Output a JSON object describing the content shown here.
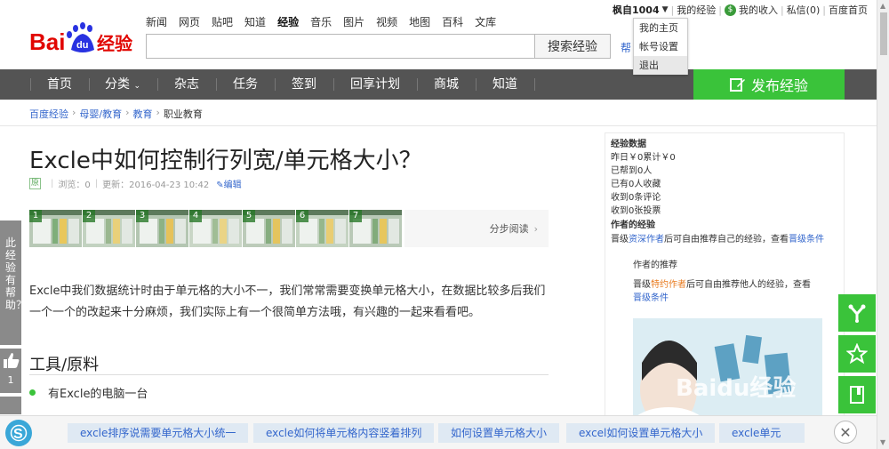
{
  "header": {
    "logo_text": "Bai经验",
    "top_nav": [
      "新闻",
      "网页",
      "贴吧",
      "知道",
      "经验",
      "音乐",
      "图片",
      "视频",
      "地图",
      "百科",
      "文库"
    ],
    "search_button": "搜索经验",
    "help_link": "帮"
  },
  "userbar": {
    "username": "枫自1004",
    "my_experience": "我的经验",
    "my_income": "我的收入",
    "messages": "私信(0)",
    "home": "百度首页"
  },
  "user_dropdown": [
    "我的主页",
    "帐号设置",
    "退出"
  ],
  "navbar": {
    "items": [
      "首页",
      "分类",
      "杂志",
      "任务",
      "签到",
      "回享计划",
      "商城",
      "知道"
    ],
    "publish": "发布经验"
  },
  "breadcrumb": [
    "百度经验",
    "母婴/教育",
    "教育",
    "职业教育"
  ],
  "article": {
    "title": "Excle中如何控制行列宽/单元格大小？",
    "original_badge": "原",
    "views": "浏览：0",
    "updated": "更新：2016-04-23 10:42",
    "edit": "编辑",
    "thumb_numbers": [
      "1",
      "2",
      "3",
      "4",
      "5",
      "6",
      "7"
    ],
    "step_read": "分步阅读",
    "intro": "Excle中我们数据统计时由于单元格的大小不一，我们常常需要变换单元格大小，在数据比较多后我们一个一个的改起来十分麻烦，我们实际上有一个很简单方法哦，有兴趣的一起来看看吧。",
    "tools_heading": "工具/原料",
    "tools": [
      "有Excle的电脑一台"
    ]
  },
  "left_float": {
    "text": "此经验有帮助？",
    "count": "1"
  },
  "sidebar": {
    "stats_title": "经验数据",
    "stats": [
      "昨日￥0累计￥0",
      "已帮到0人",
      "已有0人收藏",
      "收到0条评论",
      "收到0张投票"
    ],
    "author_exp_title": "作者的经验",
    "author_exp_pre": "晋级",
    "author_exp_link": "资深作者",
    "author_exp_mid": "后可自由推荐自己的经验，查看",
    "author_exp_link2": "晋级条件",
    "recommend_title": "作者的推荐",
    "rec_pre": "晋级",
    "rec_link": "特约作者",
    "rec_mid": "后可自由推荐他人的经验，查看",
    "rec_link2": "晋级条件"
  },
  "bottom_links": [
    "excle排序说需要单元格大小统一",
    "excle如何将单元格内容竖着排列",
    "如何设置单元格大小",
    "excel如何设置单元格大小",
    "excle单元"
  ],
  "watermark": "Baidu经验",
  "colors": {
    "green": "#3ac33a",
    "nav_bg": "#545454",
    "link": "#3366cc"
  }
}
